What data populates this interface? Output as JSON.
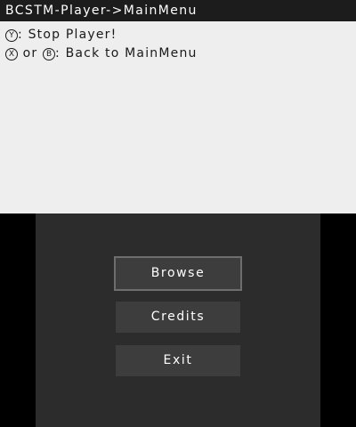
{
  "top_screen": {
    "title": "BCSTM-Player->MainMenu",
    "hints": [
      {
        "glyph": "Y",
        "text": ": Stop Player!"
      },
      {
        "glyph_a": "X",
        "between": " or ",
        "glyph_b": "B",
        "text": ": Back to MainMenu"
      }
    ]
  },
  "menu": {
    "browse_label": "Browse",
    "credits_label": "Credits",
    "exit_label": "Exit",
    "selected": "Browse"
  },
  "colors": {
    "top_background": "#eeeeee",
    "title_bar": "#1c1c1c",
    "bottom_background": "#2c2c2c",
    "button_background": "#3d3d3d",
    "selected_border": "#6e6e6e"
  }
}
